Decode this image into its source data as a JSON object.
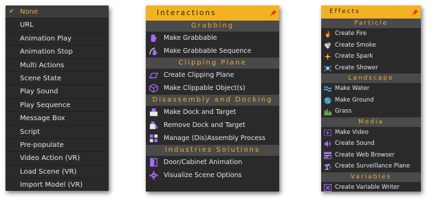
{
  "action_menu": {
    "selected_index": 0,
    "items": [
      {
        "label": "None",
        "icon": "check-icon"
      },
      {
        "label": "URL"
      },
      {
        "label": "Animation Play"
      },
      {
        "label": "Animation Stop"
      },
      {
        "label": "Multi Actions"
      },
      {
        "label": "Scene State"
      },
      {
        "label": "Play Sound"
      },
      {
        "label": "Play Sequence"
      },
      {
        "label": "Message Box"
      },
      {
        "label": "Script"
      },
      {
        "label": "Pre-populate"
      },
      {
        "label": "Video Action (VR)"
      },
      {
        "label": "Load Scene (VR)"
      },
      {
        "label": "Import Model (VR)"
      }
    ]
  },
  "interactions_panel": {
    "title": "Interactions",
    "pin_icon": "pin-icon",
    "sections": [
      {
        "title": "Grabbing",
        "items": [
          {
            "label": "Make Grabbable",
            "icon": "hand-icon"
          },
          {
            "label": "Make Grabbable Sequence",
            "icon": "hand-sequence-icon"
          }
        ]
      },
      {
        "title": "Clipping Plane",
        "items": [
          {
            "label": "Create Clipping Plane",
            "icon": "clipping-plane-icon"
          },
          {
            "label": "Make Clippable Object(s)",
            "icon": "clippable-object-icon"
          }
        ]
      },
      {
        "title": "Disassembly and Docking",
        "items": [
          {
            "label": "Make Dock and Target",
            "icon": "dock-icon"
          },
          {
            "label": "Remove Dock and Target",
            "icon": "remove-dock-icon"
          },
          {
            "label": "Manage (Dis)Assembly Process",
            "icon": "assembly-icon"
          }
        ]
      },
      {
        "title": "Industries Solutions",
        "items": [
          {
            "label": "Door/Cabinet Animation",
            "icon": "door-icon"
          },
          {
            "label": "Visualize Scene Options",
            "icon": "scene-options-icon"
          }
        ]
      }
    ]
  },
  "effects_panel": {
    "title": "Effects",
    "pin_icon": "pin-icon",
    "sections": [
      {
        "title": "Particle",
        "items": [
          {
            "label": "Create Fire",
            "icon": "fire-icon"
          },
          {
            "label": "Create Smoke",
            "icon": "smoke-icon"
          },
          {
            "label": "Create Spark",
            "icon": "spark-icon"
          },
          {
            "label": "Create Shower",
            "icon": "shower-icon"
          }
        ]
      },
      {
        "title": "Landscape",
        "items": [
          {
            "label": "Make Water",
            "icon": "water-icon"
          },
          {
            "label": "Make Ground",
            "icon": "ground-icon"
          },
          {
            "label": "Grass",
            "icon": "grass-icon"
          }
        ]
      },
      {
        "title": "Media",
        "items": [
          {
            "label": "Make Video",
            "icon": "video-icon"
          },
          {
            "label": "Create Sound",
            "icon": "sound-icon"
          },
          {
            "label": "Create Web Browser",
            "icon": "web-browser-icon"
          },
          {
            "label": "Create Surveillance Plane",
            "icon": "surveillance-icon"
          }
        ]
      },
      {
        "title": "Variables",
        "items": [
          {
            "label": "Create Variable Writer",
            "icon": "variable-writer-icon"
          }
        ]
      }
    ]
  },
  "colors": {
    "panel_bg": "#2a2a2a",
    "header_bg": "#f3b221",
    "section_bg": "#4a4a4a",
    "section_text": "#f0a73a",
    "selected_text": "#e8a23a",
    "icon_purple": "#a66cff"
  }
}
